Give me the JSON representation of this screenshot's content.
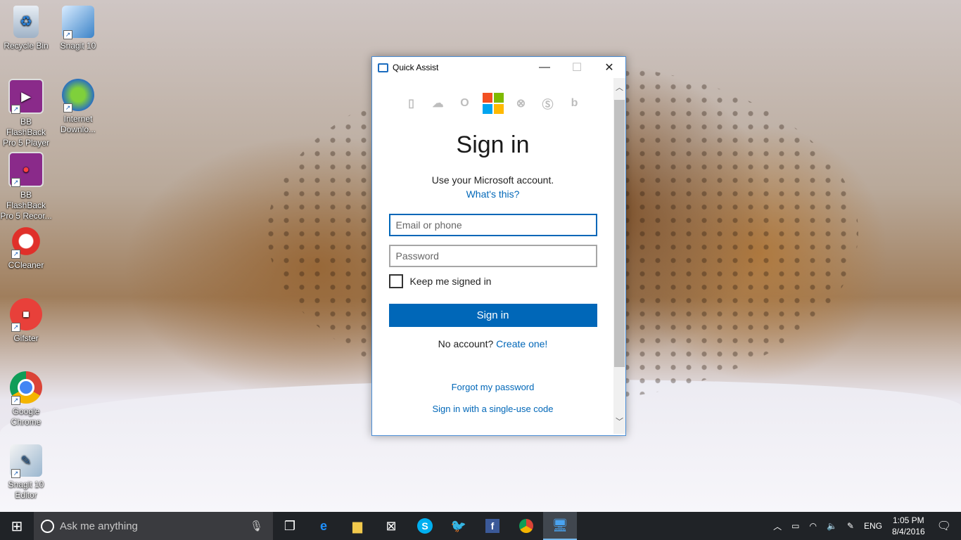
{
  "desktop": {
    "icons": [
      {
        "label": "Recycle Bin",
        "icon": "recycle-bin-icon"
      },
      {
        "label": "Snagit 10",
        "icon": "snagit-icon"
      },
      {
        "label": "BB FlashBack Pro 5 Player",
        "icon": "flashback-player-icon"
      },
      {
        "label": "Internet Downlo...",
        "icon": "internet-download-manager-icon"
      },
      {
        "label": "BB FlashBack Pro 5 Recor...",
        "icon": "flashback-recorder-icon"
      },
      {
        "label": "CCleaner",
        "icon": "ccleaner-icon"
      },
      {
        "label": "Gifster",
        "icon": "gifster-icon"
      },
      {
        "label": "Google Chrome",
        "icon": "chrome-icon"
      },
      {
        "label": "Snagit 10 Editor",
        "icon": "snagit-editor-icon"
      }
    ]
  },
  "window": {
    "title": "Quick Assist",
    "minimize": "—",
    "maximize": "☐",
    "close": "✕",
    "brand_icons": [
      "office-icon",
      "onedrive-icon",
      "outlook-icon",
      "microsoft-logo-icon",
      "xbox-icon",
      "skype-icon",
      "bing-icon"
    ],
    "heading": "Sign in",
    "subtitle": "Use your Microsoft account.",
    "whats_this": "What's this?",
    "email_placeholder": "Email or phone",
    "password_placeholder": "Password",
    "keep_signed_in": "Keep me signed in",
    "sign_in_button": "Sign in",
    "no_account": "No account?",
    "create_one": "Create one!",
    "forgot_password": "Forgot my password",
    "single_use_code": "Sign in with a single-use code",
    "ms_colors": [
      "#f25022",
      "#7fba00",
      "#00a4ef",
      "#ffb900"
    ]
  },
  "taskbar": {
    "search_placeholder": "Ask me anything",
    "pinned": [
      "task-view-icon",
      "edge-icon",
      "file-explorer-icon",
      "store-icon",
      "skype-icon",
      "twitter-icon",
      "facebook-icon",
      "chrome-icon",
      "quick-assist-icon"
    ],
    "language": "ENG",
    "time": "1:05 PM",
    "date": "8/4/2016"
  }
}
